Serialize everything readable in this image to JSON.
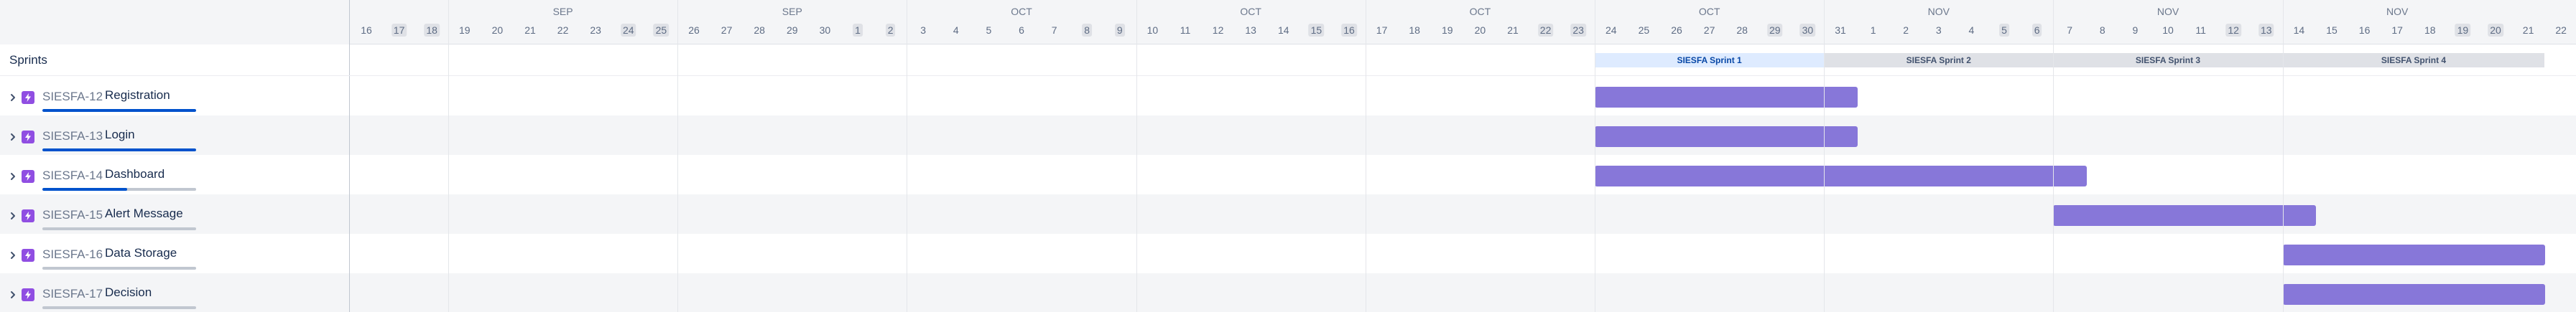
{
  "colors": {
    "accent": "#0052cc",
    "task_bar": "#8777d9",
    "active_sprint_bg": "#deebff",
    "active_sprint_text": "#0747a6",
    "future_sprint_bg": "#dfe1e6",
    "future_sprint_text": "#42526e",
    "epic_icon": "#904ee2"
  },
  "timeline": {
    "start_date": "2023-09-16",
    "days_shown": 68,
    "weeks": [
      {
        "month_label": "SEP"
      },
      {
        "month_label": "SEP"
      },
      {
        "month_label": "OCT"
      },
      {
        "month_label": "OCT"
      },
      {
        "month_label": "OCT"
      },
      {
        "month_label": "OCT"
      },
      {
        "month_label": "NOV"
      },
      {
        "month_label": "NOV"
      },
      {
        "month_label": "NOV"
      }
    ],
    "days": [
      {
        "label": "16"
      },
      {
        "label": "17",
        "weekend": true
      },
      {
        "label": "18",
        "weekend": true
      },
      {
        "label": "19"
      },
      {
        "label": "20"
      },
      {
        "label": "21"
      },
      {
        "label": "22"
      },
      {
        "label": "23"
      },
      {
        "label": "24",
        "weekend": true
      },
      {
        "label": "25",
        "weekend": true
      },
      {
        "label": "26"
      },
      {
        "label": "27"
      },
      {
        "label": "28"
      },
      {
        "label": "29"
      },
      {
        "label": "30"
      },
      {
        "label": "1",
        "weekend": true
      },
      {
        "label": "2",
        "weekend": true
      },
      {
        "label": "3"
      },
      {
        "label": "4"
      },
      {
        "label": "5"
      },
      {
        "label": "6"
      },
      {
        "label": "7"
      },
      {
        "label": "8",
        "weekend": true
      },
      {
        "label": "9",
        "weekend": true
      },
      {
        "label": "10"
      },
      {
        "label": "11"
      },
      {
        "label": "12"
      },
      {
        "label": "13"
      },
      {
        "label": "14"
      },
      {
        "label": "15",
        "weekend": true
      },
      {
        "label": "16",
        "weekend": true
      },
      {
        "label": "17"
      },
      {
        "label": "18"
      },
      {
        "label": "19"
      },
      {
        "label": "20"
      },
      {
        "label": "21"
      },
      {
        "label": "22",
        "weekend": true
      },
      {
        "label": "23",
        "weekend": true
      },
      {
        "label": "24"
      },
      {
        "label": "25"
      },
      {
        "label": "26"
      },
      {
        "label": "27"
      },
      {
        "label": "28"
      },
      {
        "label": "29",
        "weekend": true
      },
      {
        "label": "30",
        "weekend": true
      },
      {
        "label": "31"
      },
      {
        "label": "1"
      },
      {
        "label": "2"
      },
      {
        "label": "3"
      },
      {
        "label": "4"
      },
      {
        "label": "5",
        "weekend": true
      },
      {
        "label": "6",
        "weekend": true
      },
      {
        "label": "7"
      },
      {
        "label": "8"
      },
      {
        "label": "9"
      },
      {
        "label": "10"
      },
      {
        "label": "11"
      },
      {
        "label": "12",
        "weekend": true
      },
      {
        "label": "13",
        "weekend": true
      },
      {
        "label": "14"
      },
      {
        "label": "15"
      },
      {
        "label": "16"
      },
      {
        "label": "17"
      },
      {
        "label": "18"
      },
      {
        "label": "19",
        "weekend": true
      },
      {
        "label": "20",
        "weekend": true
      },
      {
        "label": "21"
      },
      {
        "label": "22"
      }
    ]
  },
  "sprints_row": {
    "label": "Sprints",
    "sprints": [
      {
        "name": "SIESFA Sprint 1",
        "start": "2023-10-24",
        "end": "2023-10-30",
        "active": true
      },
      {
        "name": "SIESFA Sprint 2",
        "start": "2023-10-31",
        "end": "2023-11-06",
        "active": false
      },
      {
        "name": "SIESFA Sprint 3",
        "start": "2023-11-07",
        "end": "2023-11-13",
        "active": false
      },
      {
        "name": "SIESFA Sprint 4",
        "start": "2023-11-14",
        "end": "2023-11-21",
        "active": false
      }
    ]
  },
  "issues": [
    {
      "key": "SIESFA-12",
      "summary": "Registration",
      "progress": 1.0,
      "icon": "epic-icon",
      "start": "2023-10-24",
      "end": "2023-11-01"
    },
    {
      "key": "SIESFA-13",
      "summary": "Login",
      "progress": 1.0,
      "icon": "epic-icon",
      "start": "2023-10-24",
      "end": "2023-11-01"
    },
    {
      "key": "SIESFA-14",
      "summary": "Dashboard",
      "progress": 0.55,
      "icon": "epic-icon",
      "start": "2023-10-24",
      "end": "2023-11-08"
    },
    {
      "key": "SIESFA-15",
      "summary": "Alert Message",
      "progress": 0.0,
      "icon": "epic-icon",
      "start": "2023-11-07",
      "end": "2023-11-15"
    },
    {
      "key": "SIESFA-16",
      "summary": "Data Storage",
      "progress": 0.0,
      "icon": "epic-icon",
      "start": "2023-11-14",
      "end": "2023-11-22"
    },
    {
      "key": "SIESFA-17",
      "summary": "Decision",
      "progress": 0.0,
      "icon": "epic-icon",
      "start": "2023-11-14",
      "end": "2023-11-22"
    }
  ]
}
